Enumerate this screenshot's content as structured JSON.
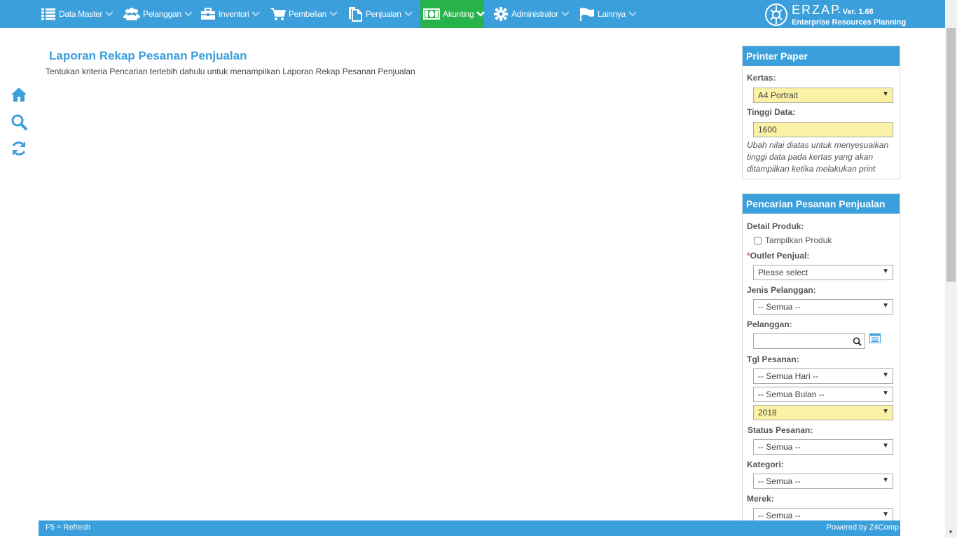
{
  "nav": {
    "items": [
      {
        "label": "Data Master",
        "icon": "list-icon"
      },
      {
        "label": "Pelanggan",
        "icon": "users-icon"
      },
      {
        "label": "Inventori",
        "icon": "briefcase-icon"
      },
      {
        "label": "Pembelian",
        "icon": "cart-icon"
      },
      {
        "label": "Penjualan",
        "icon": "document-icon"
      },
      {
        "label": "Akunting",
        "icon": "money-icon"
      },
      {
        "label": "Administrator",
        "icon": "gear-icon"
      },
      {
        "label": "Lainnya",
        "icon": "flag-icon"
      }
    ],
    "active": "Akunting"
  },
  "brand": {
    "name": "ERZAP",
    "version": "- Ver. 1.68",
    "subtitle": "Enterprise Resources Planning"
  },
  "sidebar": [
    "home-icon",
    "search-icon",
    "refresh-icon"
  ],
  "main": {
    "title": "Laporan Rekap Pesanan Penjualan",
    "description": "Tentukan kriteria Pencarian terlebih dahulu untuk menampilkan Laporan Rekap Pesanan Penjualan"
  },
  "printer_panel": {
    "title": "Printer Paper",
    "kertas_label": "Kertas:",
    "kertas_value": "A4 Portrait",
    "tinggi_label": "Tinggi Data:",
    "tinggi_value": "1600",
    "hint": "Ubah nilai diatas untuk menyesuaikan tinggi data pada kertas yang akan ditampilkan ketika melakukan print"
  },
  "search_panel": {
    "title": "Pencarian Pesanan Penjualan",
    "detail_label": "Detail Produk:",
    "tampilkan_label": "Tampilkan Produk",
    "outlet_required": "*",
    "outlet_label": "Outlet Penjual:",
    "outlet_value": "Please select",
    "jenis_label": "Jenis Pelanggan:",
    "jenis_value": "-- Semua --",
    "pelanggan_label": "Pelanggan:",
    "pelanggan_value": "",
    "tgl_label": "Tgl Pesanan:",
    "hari_value": "-- Semua Hari --",
    "bulan_value": "-- Semua Bulan --",
    "tahun_value": "2018",
    "status_label": "Status Pesanan:",
    "status_value": "-- Semua --",
    "kategori_label": "Kategori:",
    "kategori_value": "-- Semua --",
    "merek_label": "Merek:",
    "merek_value": "-- Semua --"
  },
  "footer": {
    "left": "F5 = Refresh",
    "right": "Powered by Z4Comp"
  },
  "colors": {
    "primary": "#3b9fdb",
    "active": "#28b34a",
    "highlight": "#fbf2a6"
  }
}
